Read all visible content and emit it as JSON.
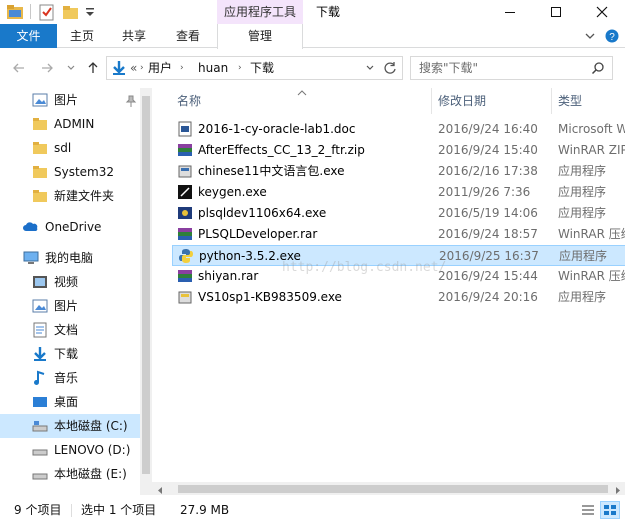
{
  "window": {
    "title": "下载",
    "context_tab": "应用程序工具"
  },
  "ribbon": {
    "tabs": [
      "文件",
      "主页",
      "共享",
      "查看",
      "管理"
    ]
  },
  "address": {
    "overflow": "«",
    "crumbs": [
      "用户",
      "huan",
      "下载"
    ]
  },
  "search": {
    "placeholder": "搜索\"下载\""
  },
  "nav": {
    "items": [
      {
        "label": "图片",
        "icon": "pictures-icon"
      },
      {
        "label": "ADMIN",
        "icon": "folder-icon"
      },
      {
        "label": "sdl",
        "icon": "folder-icon"
      },
      {
        "label": "System32",
        "icon": "folder-icon"
      },
      {
        "label": "新建文件夹",
        "icon": "folder-icon"
      },
      {
        "label": "OneDrive",
        "icon": "cloud-icon"
      },
      {
        "label": "我的电脑",
        "icon": "computer-icon"
      },
      {
        "label": "视频",
        "icon": "videos-icon"
      },
      {
        "label": "图片",
        "icon": "pictures-icon"
      },
      {
        "label": "文档",
        "icon": "documents-icon"
      },
      {
        "label": "下载",
        "icon": "downloads-icon"
      },
      {
        "label": "音乐",
        "icon": "music-icon"
      },
      {
        "label": "桌面",
        "icon": "desktop-icon"
      },
      {
        "label": "本地磁盘 (C:)",
        "icon": "drive-icon"
      },
      {
        "label": "LENOVO (D:)",
        "icon": "drive-icon"
      },
      {
        "label": "本地磁盘 (E:)",
        "icon": "drive-icon"
      }
    ]
  },
  "columns": [
    "名称",
    "修改日期",
    "类型"
  ],
  "files": [
    {
      "name": "2016-1-cy-oracle-lab1.doc",
      "date": "2016/9/24 16:40",
      "type": "Microsoft W",
      "icon": "doc-icon"
    },
    {
      "name": "AfterEffects_CC_13_2_ftr.zip",
      "date": "2016/9/24 15:40",
      "type": "WinRAR ZIP",
      "icon": "winrar-icon"
    },
    {
      "name": "chinese11中文语言包.exe",
      "date": "2016/2/16 17:38",
      "type": "应用程序",
      "icon": "installer-icon"
    },
    {
      "name": "keygen.exe",
      "date": "2011/9/26 7:36",
      "type": "应用程序",
      "icon": "keygen-icon"
    },
    {
      "name": "plsqldev1106x64.exe",
      "date": "2016/5/19 14:06",
      "type": "应用程序",
      "icon": "plsql-icon"
    },
    {
      "name": "PLSQLDeveloper.rar",
      "date": "2016/9/24 18:57",
      "type": "WinRAR 压缩",
      "icon": "winrar-icon"
    },
    {
      "name": "python-3.5.2.exe",
      "date": "2016/9/25 16:37",
      "type": "应用程序",
      "icon": "python-icon"
    },
    {
      "name": "shiyan.rar",
      "date": "2016/9/24 15:44",
      "type": "WinRAR 压缩",
      "icon": "winrar-icon"
    },
    {
      "name": "VS10sp1-KB983509.exe",
      "date": "2016/9/24 20:16",
      "type": "应用程序",
      "icon": "installer-icon"
    }
  ],
  "watermark": "http://blog.csdn.net/",
  "status": {
    "count": "9 个项目",
    "selected": "选中 1 个项目",
    "size": "27.9 MB"
  },
  "colors": {
    "accent": "#1979ca",
    "selection": "#cce8ff",
    "context_tab": "#f4e4fb"
  }
}
